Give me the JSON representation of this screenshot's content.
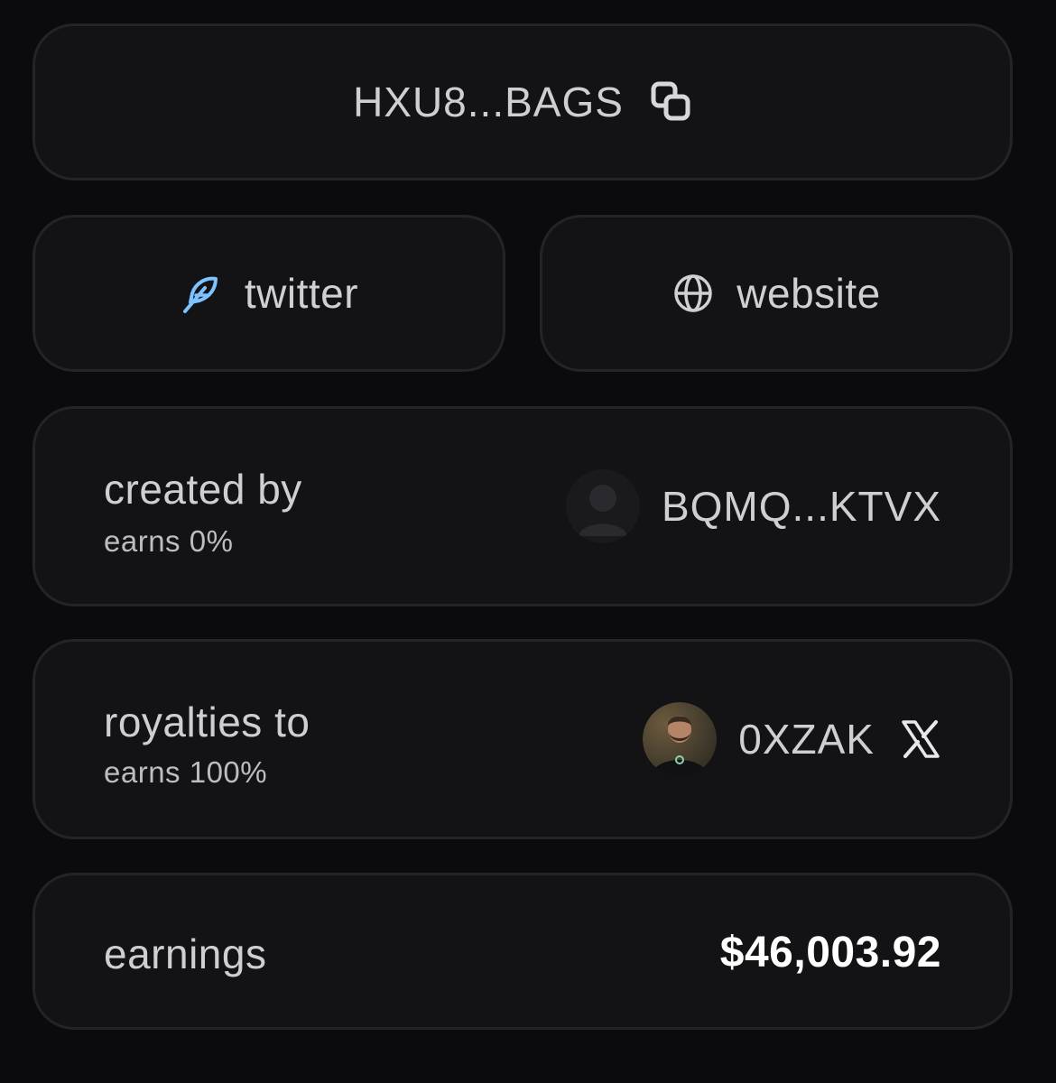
{
  "token": {
    "address_short": "HXU8...BAGS",
    "copy_icon": "copy-icon"
  },
  "links": {
    "twitter_label": "twitter",
    "twitter_icon": "feather-icon",
    "twitter_icon_color": "#7cc3ff",
    "website_label": "website",
    "website_icon": "globe-icon"
  },
  "creator": {
    "title": "created by",
    "subtitle": "earns 0%",
    "name": "BQMQ...KTVX",
    "avatar": "default-user-avatar"
  },
  "royalties": {
    "title": "royalties to",
    "subtitle": "earns 100%",
    "name": "0XZAK",
    "avatar": "user-photo-avatar",
    "social_icon": "x-icon"
  },
  "earnings": {
    "label": "earnings",
    "value": "$46,003.92"
  },
  "colors": {
    "background": "#0b0b0d",
    "card": "#131315",
    "border": "#242427",
    "text": "#cfcfd1",
    "accent": "#7cc3ff",
    "value": "#ffffff"
  }
}
